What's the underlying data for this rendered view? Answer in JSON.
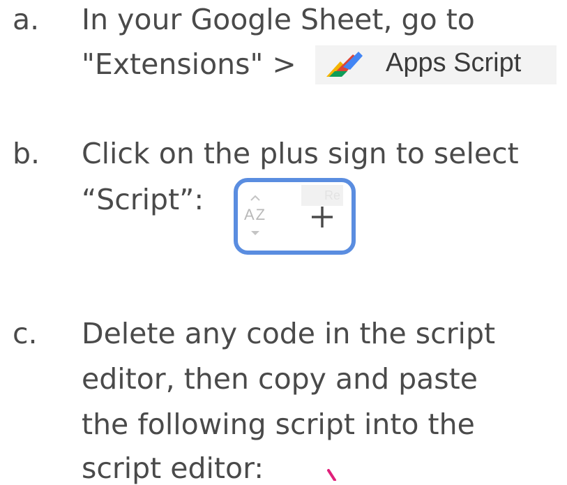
{
  "steps": [
    {
      "marker": "a.",
      "lines": [
        "In your Google Sheet, go to",
        "\"Extensions\" >"
      ],
      "inline_badge": {
        "icon": "apps-script-logo-icon",
        "label": "Apps Script"
      }
    },
    {
      "marker": "b.",
      "lines": [
        "Click on the plus sign to select",
        "“Script”:"
      ],
      "inline_toolbar": {
        "sort_label": "AZ",
        "sort_icon": "sort-az-icon",
        "faded_tab_label": "Re",
        "add_icon": "plus-icon",
        "highlight_color": "#5a8de0"
      }
    },
    {
      "marker": "c.",
      "lines": [
        "Delete any code in the script",
        "editor, then copy and paste",
        "the following script into the",
        "script editor:"
      ]
    }
  ],
  "colors": {
    "text": "#4a4a4a",
    "annotation_pen": "#e0207a"
  }
}
